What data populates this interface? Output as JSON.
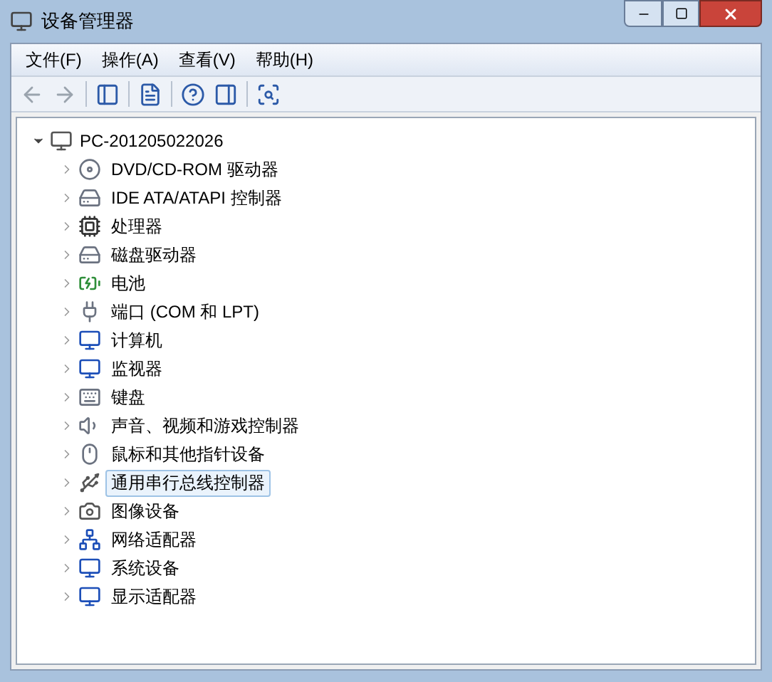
{
  "window": {
    "title": "设备管理器"
  },
  "menu": [
    "文件(F)",
    "操作(A)",
    "查看(V)",
    "帮助(H)"
  ],
  "toolbar": [
    {
      "kind": "back",
      "disabled": true
    },
    {
      "kind": "forward",
      "disabled": true
    },
    {
      "kind": "tree",
      "disabled": false
    },
    {
      "kind": "properties",
      "disabled": false
    },
    {
      "kind": "help",
      "disabled": false
    },
    {
      "kind": "pane",
      "disabled": false
    },
    {
      "kind": "scan",
      "disabled": false
    }
  ],
  "tree": {
    "label": "PC-201205022026",
    "expanded": true,
    "children": [
      {
        "label": "DVD/CD-ROM 驱动器",
        "kind": "disc",
        "expanded": false,
        "selected": false
      },
      {
        "label": "IDE ATA/ATAPI 控制器",
        "kind": "drive",
        "expanded": false,
        "selected": false
      },
      {
        "label": "处理器",
        "kind": "cpu",
        "expanded": false,
        "selected": false
      },
      {
        "label": "磁盘驱动器",
        "kind": "drive",
        "expanded": false,
        "selected": false
      },
      {
        "label": "电池",
        "kind": "battery",
        "expanded": false,
        "selected": false
      },
      {
        "label": "端口 (COM 和 LPT)",
        "kind": "plug",
        "expanded": false,
        "selected": false
      },
      {
        "label": "计算机",
        "kind": "monitor",
        "expanded": false,
        "selected": false
      },
      {
        "label": "监视器",
        "kind": "monitor",
        "expanded": false,
        "selected": false
      },
      {
        "label": "键盘",
        "kind": "keyboard",
        "expanded": false,
        "selected": false
      },
      {
        "label": "声音、视频和游戏控制器",
        "kind": "speaker",
        "expanded": false,
        "selected": false
      },
      {
        "label": "鼠标和其他指针设备",
        "kind": "mouse",
        "expanded": false,
        "selected": false
      },
      {
        "label": "通用串行总线控制器",
        "kind": "usb",
        "expanded": false,
        "selected": true
      },
      {
        "label": "图像设备",
        "kind": "camera",
        "expanded": false,
        "selected": false
      },
      {
        "label": "网络适配器",
        "kind": "network",
        "expanded": false,
        "selected": false
      },
      {
        "label": "系统设备",
        "kind": "monitor",
        "expanded": false,
        "selected": false
      },
      {
        "label": "显示适配器",
        "kind": "monitor",
        "expanded": false,
        "selected": false
      }
    ]
  }
}
